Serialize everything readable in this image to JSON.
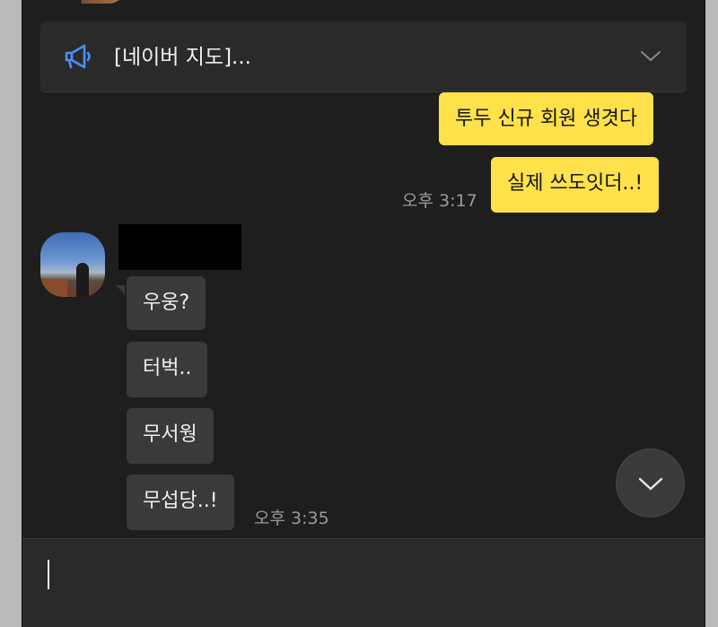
{
  "notice": {
    "text": "[네이버 지도]..."
  },
  "messages_mine": [
    {
      "text": "투두 신규 회원 생겻다"
    },
    {
      "text": "실제 쓰도잇더..!"
    }
  ],
  "time_mine": "오후 3:17",
  "messages_theirs": [
    {
      "text": "우웅?"
    },
    {
      "text": "터벅.."
    },
    {
      "text": "무서웡"
    },
    {
      "text": "무섭당..!"
    }
  ],
  "time_theirs": "오후 3:35",
  "colors": {
    "my_bubble": "#ffe14a",
    "their_bubble": "#3a3a3a",
    "background": "#1e1e1e",
    "notice_icon": "#4f8ef7"
  }
}
